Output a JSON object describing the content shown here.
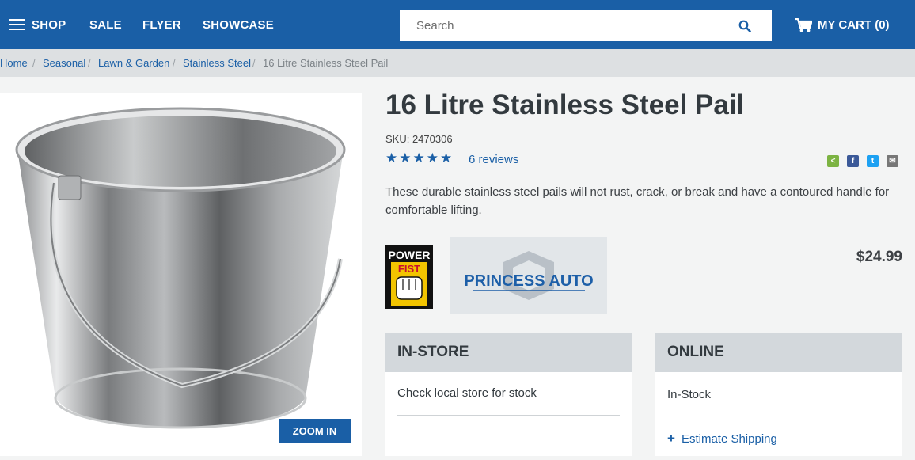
{
  "nav": {
    "shop": "SHOP",
    "sale": "SALE",
    "flyer": "FLYER",
    "showcase": "SHOWCASE",
    "cart": "MY CART (0)"
  },
  "search": {
    "placeholder": "Search"
  },
  "breadcrumb": {
    "items": [
      "Home",
      "Seasonal",
      "Lawn & Garden",
      "Stainless Steel"
    ],
    "current": "16 Litre Stainless Steel Pail"
  },
  "product": {
    "title": "16 Litre Stainless Steel Pail",
    "sku": "SKU: 2470306",
    "rating": 5,
    "stars": "★★★★★",
    "reviews": "6 reviews",
    "description": "These durable stainless steel pails will not rust, crack, or break and have a contoured handle for comfortable lifting.",
    "price": "$24.99",
    "zoom_label": "ZOOM IN"
  },
  "brands": {
    "power_fist": [
      "POWER",
      "FIST"
    ],
    "princess_auto": "PRINCESS AUTO"
  },
  "availability": {
    "instore_title": "IN-STORE",
    "instore_text": "Check local store for stock",
    "online_title": "ONLINE",
    "online_text": "In-Stock",
    "shipping_label": "Estimate Shipping"
  },
  "colors": {
    "brand_blue": "#1a5fa6",
    "breadcrumb_bg": "#dde0e2",
    "panel_header": "#d3d8dc",
    "share_green": "#7cb342",
    "facebook": "#3b5998",
    "twitter": "#1da1f2",
    "email": "#777777"
  }
}
